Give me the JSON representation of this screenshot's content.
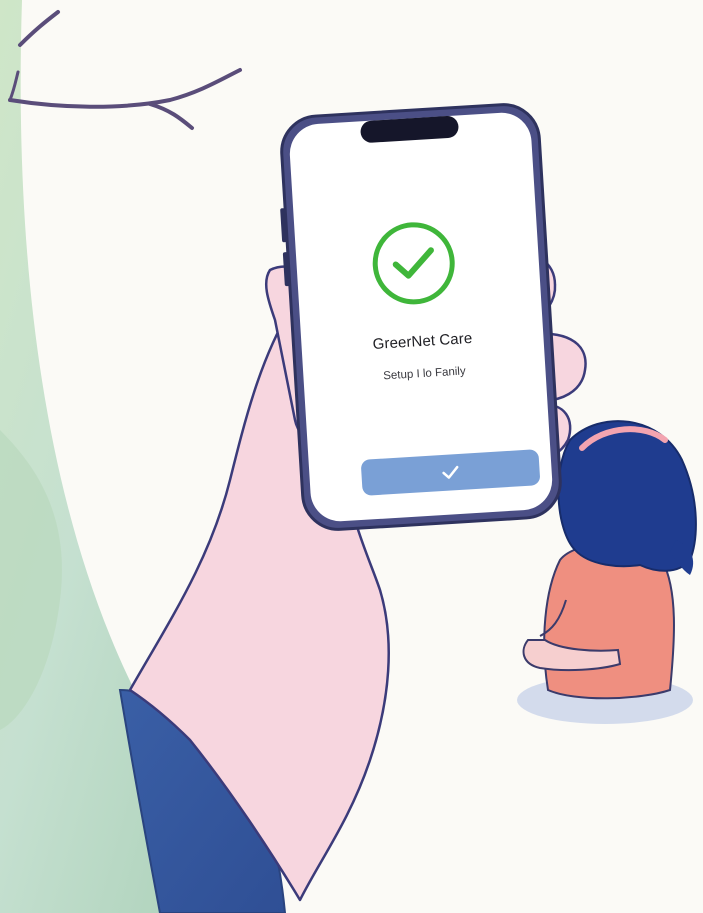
{
  "app": {
    "title": "GreerNet Care",
    "subtitle": "Setup I lo Fanily"
  },
  "icons": {
    "status": "check-circle-icon",
    "button": "check-icon"
  },
  "colors": {
    "success_green": "#3fb63a",
    "button_blue": "#7aa0d6",
    "phone_frame": "#4b4f86",
    "sleeve_blue": "#3f66ad",
    "hand_skin": "#f7d6df",
    "hair_navy": "#1f3c8f",
    "dress_coral": "#ef8f80",
    "background": "#fbfaf6"
  }
}
